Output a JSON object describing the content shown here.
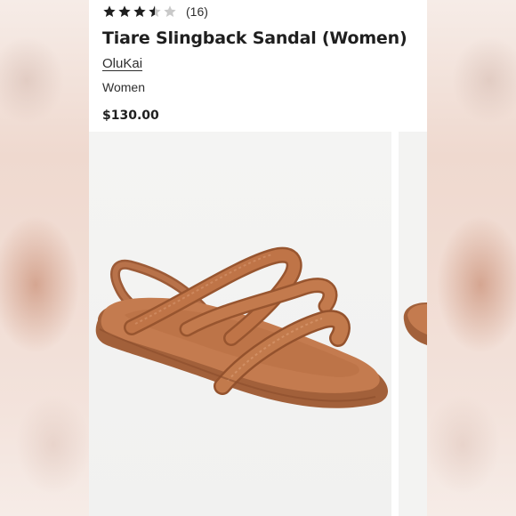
{
  "product": {
    "rating_value": 3.5,
    "rating_max": 5,
    "review_count": "(16)",
    "title": "Tiare Slingback Sandal (Women)",
    "brand": "OluKai",
    "department": "Women",
    "price": "$130.00"
  },
  "icons": {
    "star_full": "star-full-icon",
    "star_half": "star-half-icon",
    "star_empty": "star-empty-icon"
  },
  "colors": {
    "star_filled": "#1f1f1f",
    "star_empty": "#c9c9c9",
    "sandal_leather": "#b06b42",
    "background_panel": "#ffffff"
  }
}
